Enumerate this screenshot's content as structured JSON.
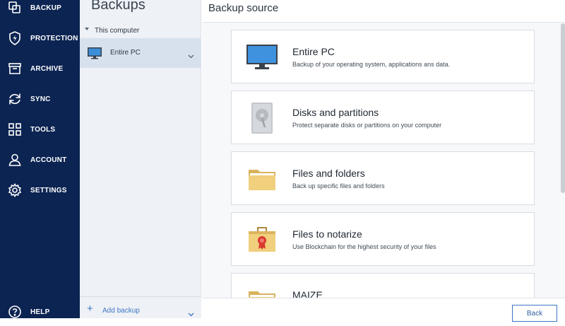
{
  "nav": {
    "items": [
      {
        "label": "BACKUP",
        "icon": "backup-icon"
      },
      {
        "label": "PROTECTION",
        "icon": "shield-bolt-icon"
      },
      {
        "label": "ARCHIVE",
        "icon": "archive-box-icon"
      },
      {
        "label": "SYNC",
        "icon": "sync-arrows-icon"
      },
      {
        "label": "TOOLS",
        "icon": "grid-icon"
      },
      {
        "label": "ACCOUNT",
        "icon": "person-icon"
      },
      {
        "label": "SETTINGS",
        "icon": "gear-icon"
      }
    ],
    "help": {
      "label": "HELP",
      "icon": "help-circle-icon"
    }
  },
  "backups": {
    "title": "Backups",
    "group": "This computer",
    "selected_item": "Entire PC",
    "add_label": "Add backup"
  },
  "main": {
    "title": "Backup source",
    "options": [
      {
        "title": "Entire PC",
        "description": "Backup of your operating system, applications ans data.",
        "icon": "monitor-icon"
      },
      {
        "title": "Disks and partitions",
        "description": "Protect separate disks or partitions on your computer",
        "icon": "hard-disk-icon"
      },
      {
        "title": "Files and folders",
        "description": "Back up specific files and folders",
        "icon": "folder-icon"
      },
      {
        "title": "Files to notarize",
        "description": "Use Blockchain for the highest security of your files",
        "icon": "briefcase-seal-icon"
      },
      {
        "title": "MAIZE",
        "description": "",
        "icon": "folder-icon"
      }
    ],
    "back_label": "Back"
  },
  "colors": {
    "nav_bg": "#0c2452",
    "accent": "#3d77c4",
    "selected_bg": "#d7e1ee"
  }
}
